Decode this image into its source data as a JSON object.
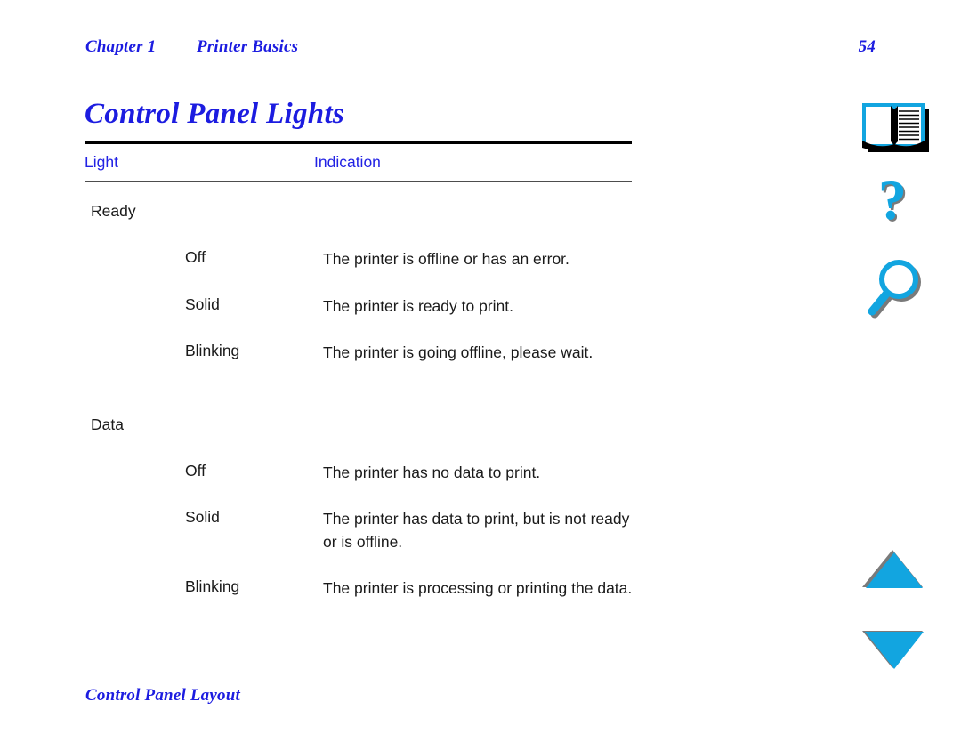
{
  "header": {
    "chapter": "Chapter 1",
    "title": "Printer Basics",
    "page_number": "54"
  },
  "doc_title": "Control Panel Lights",
  "table": {
    "columns": [
      "Light",
      "Indication"
    ],
    "groups": [
      {
        "label": "Ready",
        "rows": [
          {
            "state": "Off",
            "description": "The printer is offline or has an error."
          },
          {
            "state": "Solid",
            "description": "The printer is ready to print."
          },
          {
            "state": "Blinking",
            "description": "The printer is going offline, please wait."
          }
        ]
      },
      {
        "label": "Data",
        "rows": [
          {
            "state": "Off",
            "description": "The printer has no data to print."
          },
          {
            "state": "Solid",
            "description": "The printer has data to print, but is not ready or is offline."
          },
          {
            "state": "Blinking",
            "description": "The printer is processing or printing the data."
          }
        ]
      }
    ]
  },
  "footer": {
    "link": "Control Panel Layout"
  },
  "nav": {
    "book": "book-icon",
    "help": "question-mark-icon",
    "search": "magnifier-icon",
    "prev": "triangle-up-icon",
    "next": "triangle-down-icon"
  },
  "colors": {
    "heading_blue": "#1c1ce0",
    "icon_cyan": "#12a5e0",
    "icon_shadow": "#7a7a7a",
    "rule_black": "#000000",
    "body_text": "#1a1a1a"
  }
}
